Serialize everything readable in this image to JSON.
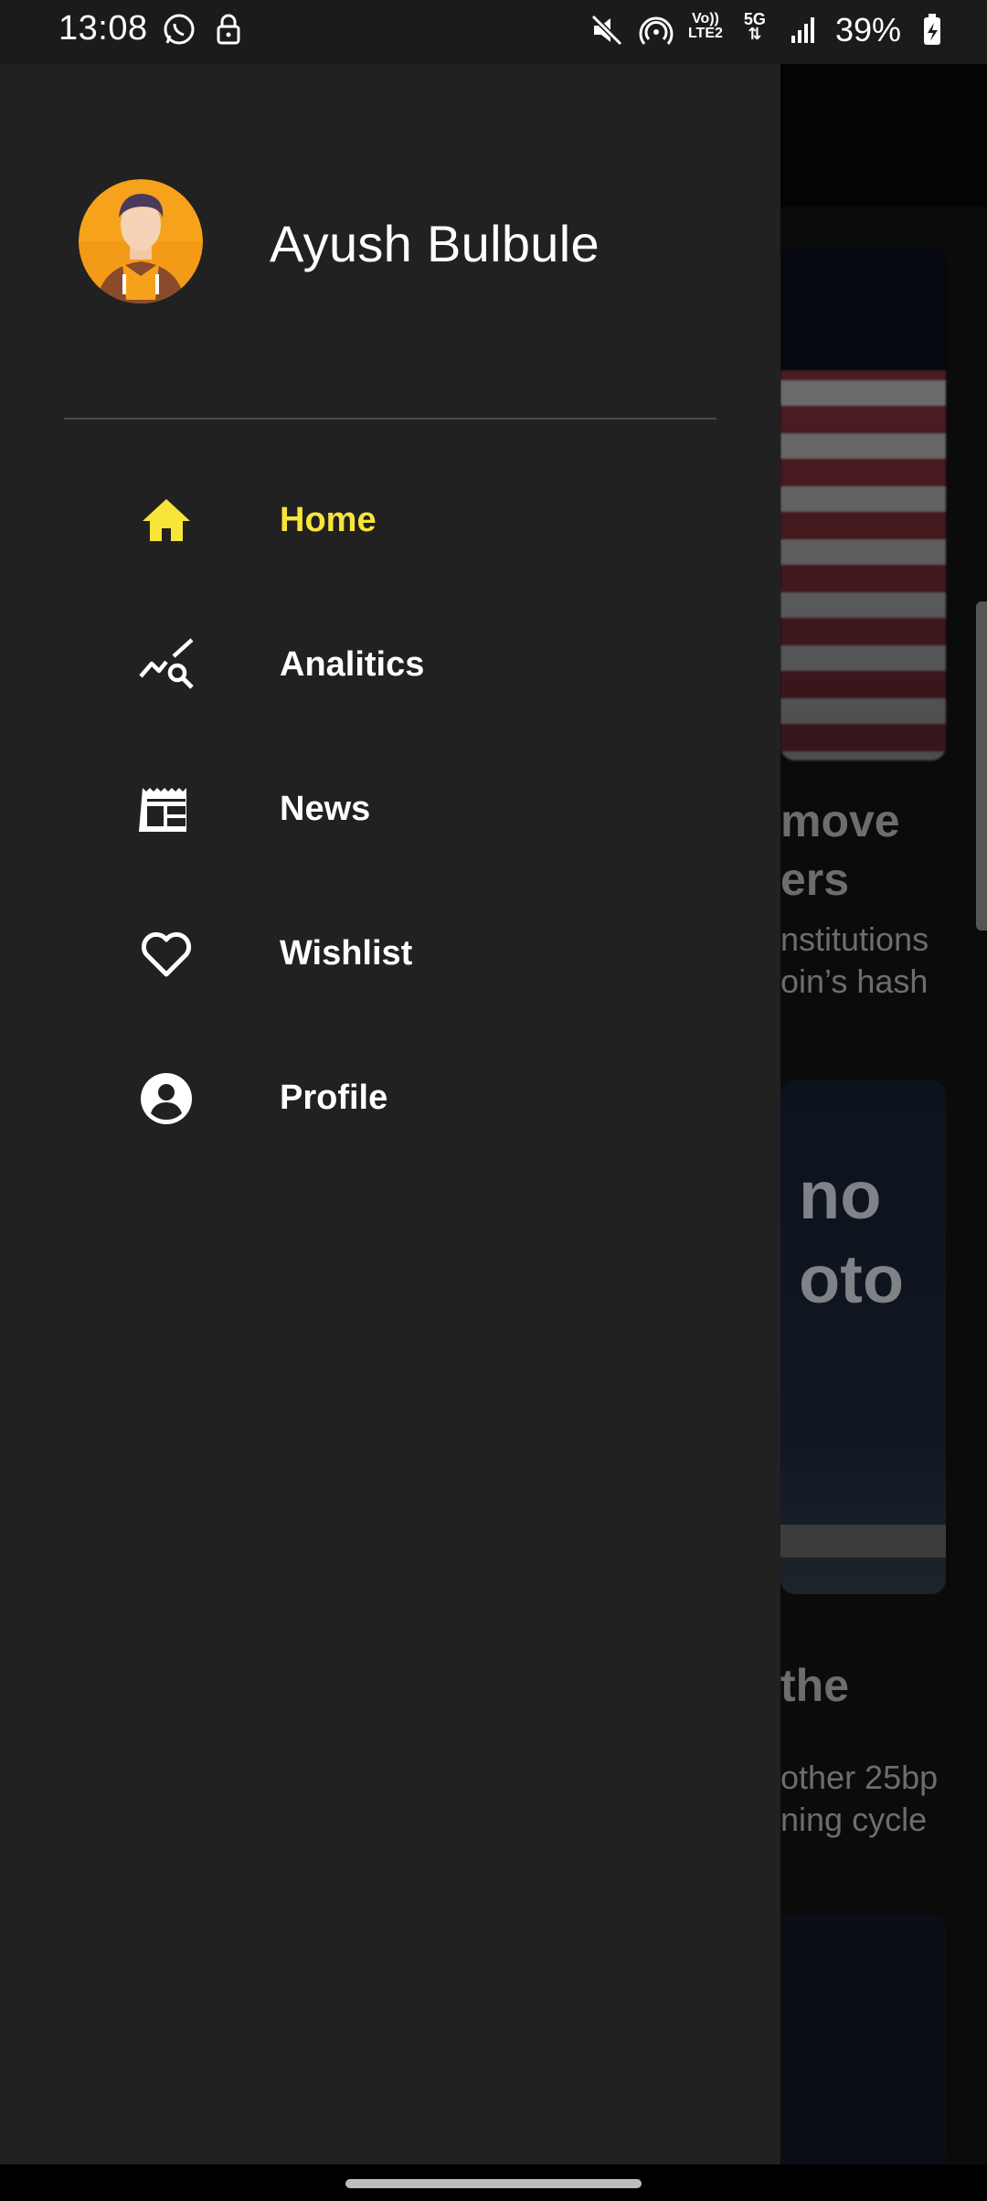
{
  "status_bar": {
    "time": "13:08",
    "battery": "39%",
    "left_icons": [
      "whatsapp-icon",
      "lock-icon"
    ],
    "right_icons": [
      "mute-icon",
      "hotspot-icon",
      "volte-icon",
      "5g-icon",
      "signal-icon",
      "battery-charging-icon"
    ],
    "volte_label_top": "Vo))",
    "volte_label_bottom": "LTE2",
    "network_label": "5G"
  },
  "drawer": {
    "user_name": "Ayush Bulbule",
    "accent_color": "#f8e53a",
    "items": [
      {
        "label": "Home",
        "icon": "home-icon",
        "active": true
      },
      {
        "label": "Analitics",
        "icon": "analytics-icon",
        "active": false
      },
      {
        "label": "News",
        "icon": "news-icon",
        "active": false
      },
      {
        "label": "Wishlist",
        "icon": "heart-icon",
        "active": false
      },
      {
        "label": "Profile",
        "icon": "account-circle-icon",
        "active": false
      }
    ]
  },
  "background": {
    "card1_title_line1": "move",
    "card1_title_line2": "ers",
    "card1_sub_line1": "nstitutions",
    "card1_sub_line2": "oin’s hash",
    "card2_image_text_line1": "no",
    "card2_image_text_line2": "oto",
    "card2_title_line1": "the",
    "card2_sub_line1": "other 25bp",
    "card2_sub_line2": "ning cycle"
  }
}
